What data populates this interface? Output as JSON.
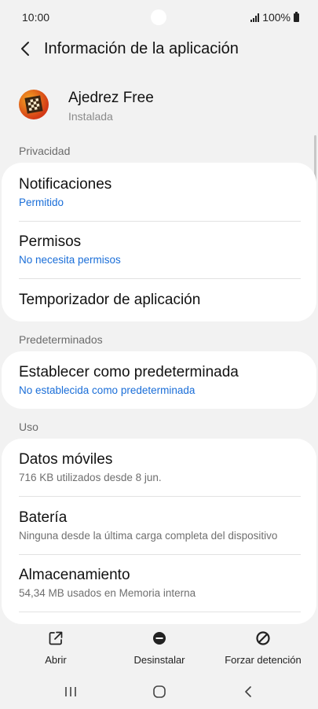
{
  "status_bar": {
    "time": "10:00",
    "battery": "100%"
  },
  "header": {
    "title": "Información de la aplicación"
  },
  "app": {
    "name": "Ajedrez Free",
    "status": "Instalada"
  },
  "sections": {
    "privacy": "Privacidad",
    "defaults": "Predeterminados",
    "usage": "Uso"
  },
  "items": {
    "notifications": {
      "title": "Notificaciones",
      "sub": "Permitido"
    },
    "permissions": {
      "title": "Permisos",
      "sub": "No necesita permisos"
    },
    "app_timer": {
      "title": "Temporizador de aplicación"
    },
    "set_default": {
      "title": "Establecer como predeterminada",
      "sub": "No establecida como predeterminada"
    },
    "mobile_data": {
      "title": "Datos móviles",
      "sub": "716 KB utilizados desde 8 jun."
    },
    "battery": {
      "title": "Batería",
      "sub": "Ninguna desde la última carga completa del dispositivo"
    },
    "storage": {
      "title": "Almacenamiento",
      "sub": "54,34 MB usados en Memoria interna"
    }
  },
  "actions": {
    "open": "Abrir",
    "uninstall": "Desinstalar",
    "force_stop": "Forzar detención"
  },
  "colors": {
    "accent": "#1a6ed8",
    "background": "#f2f2f2",
    "card": "#ffffff"
  }
}
